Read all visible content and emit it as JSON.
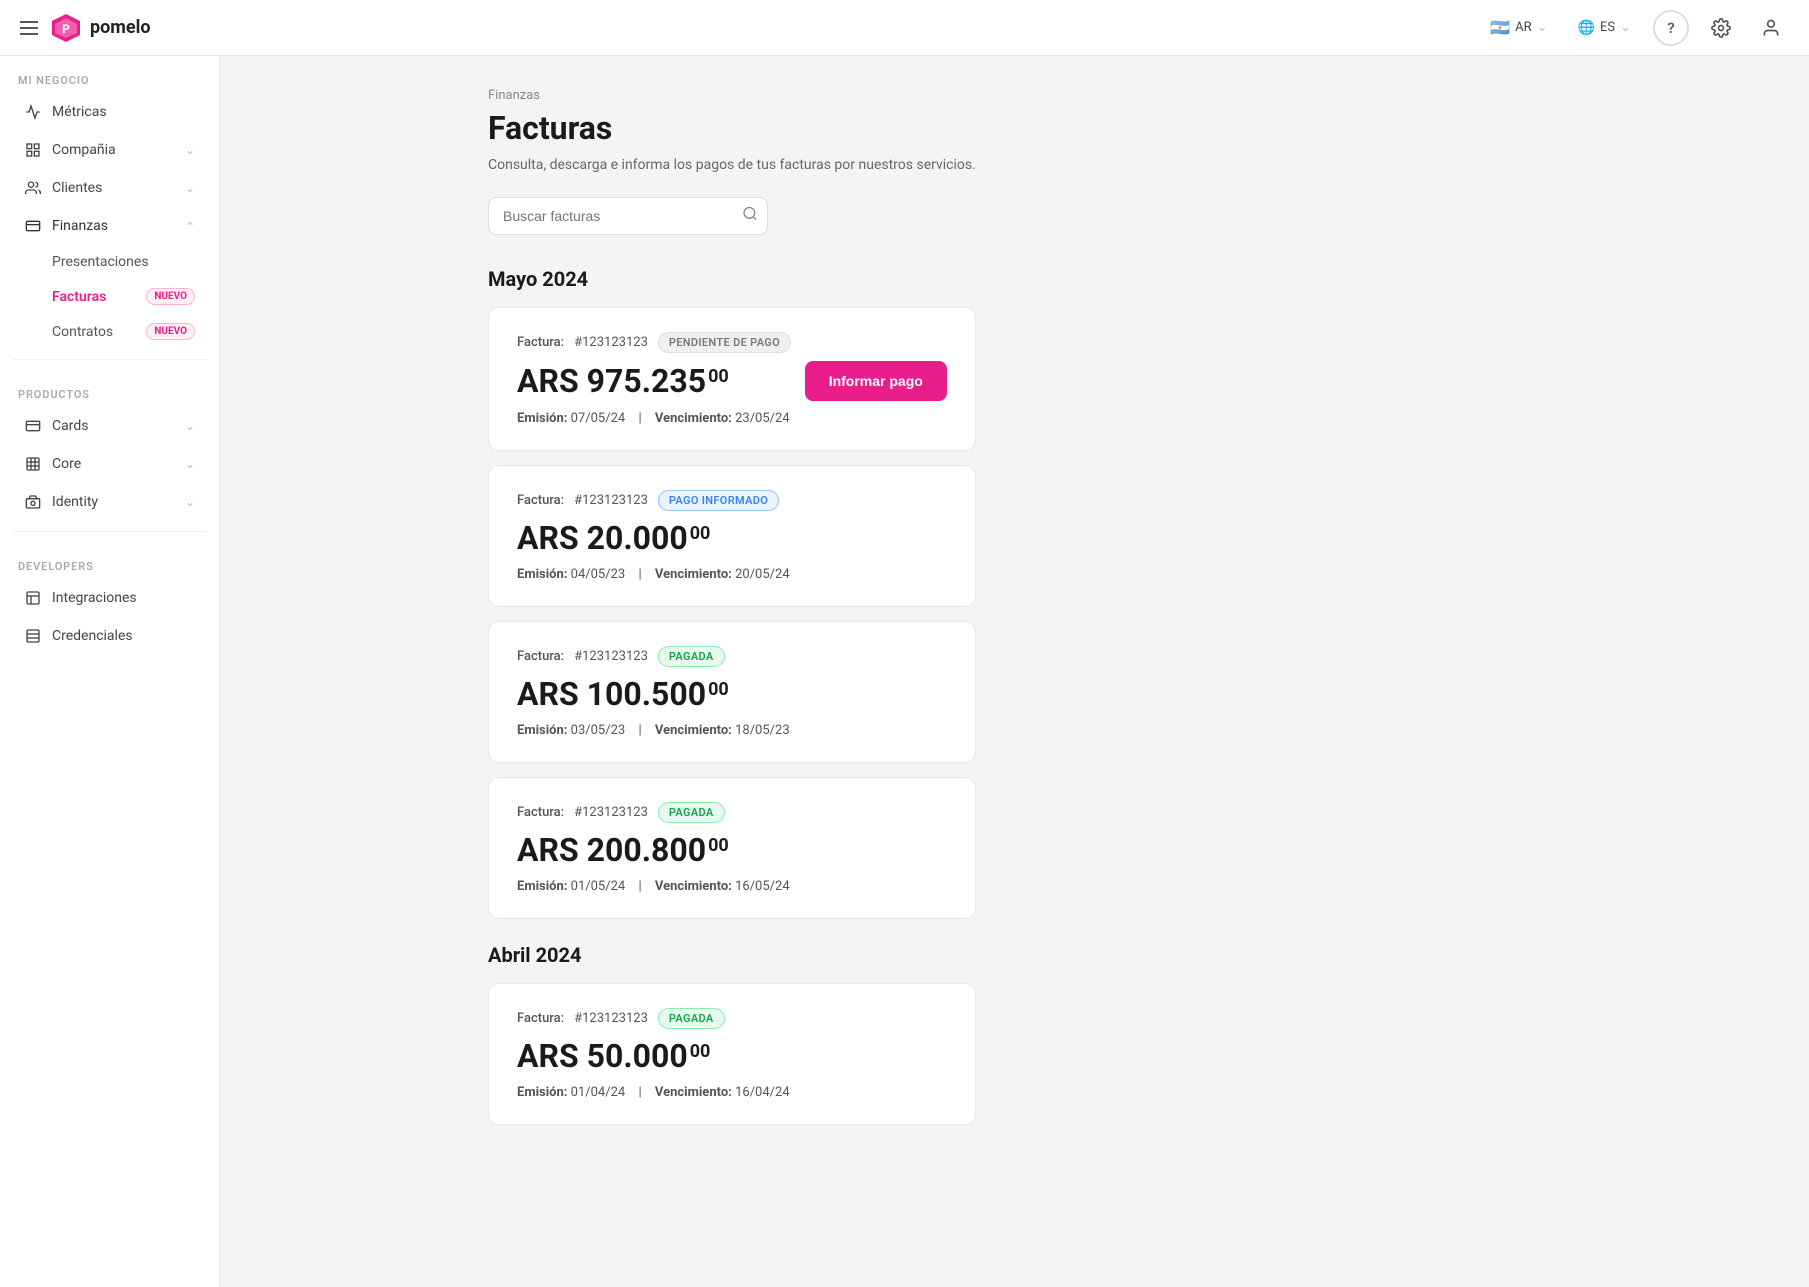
{
  "topbar": {
    "hamburger_label": "menu",
    "logo_text": "pomelo",
    "country_flag": "🇦🇷",
    "country_code": "AR",
    "language_code": "ES",
    "help_icon": "?",
    "settings_icon": "⚙",
    "user_icon": "👤"
  },
  "sidebar": {
    "section_my_business": "MI NEGOCIO",
    "metrics_label": "Métricas",
    "company_label": "Compañia",
    "clients_label": "Clientes",
    "finances_label": "Finanzas",
    "sub_presentations": "Presentaciones",
    "sub_invoices": "Facturas",
    "sub_contracts": "Contratos",
    "section_products": "PRODUCTOS",
    "cards_label": "Cards",
    "core_label": "Core",
    "identity_label": "Identity",
    "section_developers": "DEVELOPERS",
    "integrations_label": "Integraciones",
    "credentials_label": "Credenciales",
    "badge_new": "NUEVO"
  },
  "page": {
    "breadcrumb": "Finanzas",
    "title": "Facturas",
    "subtitle": "Consulta, descarga e informa los pagos de tus facturas por nuestros servicios.",
    "search_placeholder": "Buscar facturas"
  },
  "sections": [
    {
      "title": "Mayo 2024",
      "invoices": [
        {
          "label": "Factura:",
          "number": "#123123123",
          "status": "PENDIENTE DE PAGO",
          "status_type": "pending",
          "amount": "ARS 975.235",
          "cents": "00",
          "emission_label": "Emisión:",
          "emission_date": "07/05/24",
          "due_label": "Vencimiento:",
          "due_date": "23/05/24",
          "has_button": true,
          "button_label": "Informar pago"
        },
        {
          "label": "Factura:",
          "number": "#123123123",
          "status": "PAGO INFORMADO",
          "status_type": "informed",
          "amount": "ARS 20.000",
          "cents": "00",
          "emission_label": "Emisión:",
          "emission_date": "04/05/23",
          "due_label": "Vencimiento:",
          "due_date": "20/05/24",
          "has_button": false
        },
        {
          "label": "Factura:",
          "number": "#123123123",
          "status": "PAGADA",
          "status_type": "paid",
          "amount": "ARS 100.500",
          "cents": "00",
          "emission_label": "Emisión:",
          "emission_date": "03/05/23",
          "due_label": "Vencimiento:",
          "due_date": "18/05/23",
          "has_button": false
        },
        {
          "label": "Factura:",
          "number": "#123123123",
          "status": "PAGADA",
          "status_type": "paid",
          "amount": "ARS 200.800",
          "cents": "00",
          "emission_label": "Emisión:",
          "emission_date": "01/05/24",
          "due_label": "Vencimiento:",
          "due_date": "16/05/24",
          "has_button": false
        }
      ]
    },
    {
      "title": "Abril 2024",
      "invoices": [
        {
          "label": "Factura:",
          "number": "#123123123",
          "status": "PAGADA",
          "status_type": "paid",
          "amount": "ARS 50.000",
          "cents": "00",
          "emission_label": "Emisión:",
          "emission_date": "01/04/24",
          "due_label": "Vencimiento:",
          "due_date": "16/04/24",
          "has_button": false
        }
      ]
    }
  ]
}
